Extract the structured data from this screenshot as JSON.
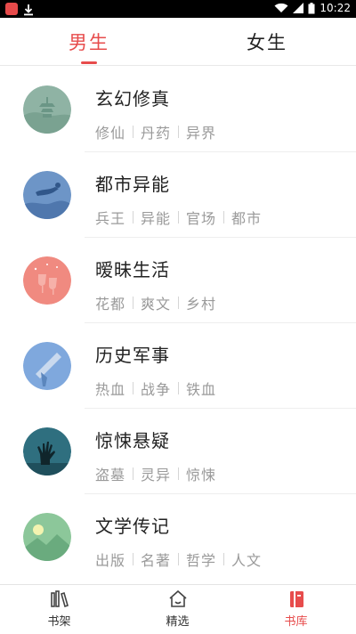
{
  "status_bar": {
    "time": "10:22"
  },
  "tabs": [
    {
      "label": "男生",
      "active": true
    },
    {
      "label": "女生",
      "active": false
    }
  ],
  "categories": [
    {
      "title": "玄幻修真",
      "tags": [
        "修仙",
        "丹药",
        "异界"
      ],
      "icon": "pagoda-icon",
      "color": "#8fb3a4"
    },
    {
      "title": "都市异能",
      "tags": [
        "兵王",
        "异能",
        "官场",
        "都市"
      ],
      "icon": "diver-icon",
      "color": "#6d95c7"
    },
    {
      "title": "暧昧生活",
      "tags": [
        "花都",
        "爽文",
        "乡村"
      ],
      "icon": "wine-glasses-icon",
      "color": "#f08a80"
    },
    {
      "title": "历史军事",
      "tags": [
        "热血",
        "战争",
        "铁血"
      ],
      "icon": "telescope-icon",
      "color": "#7fa8dd"
    },
    {
      "title": "惊悚悬疑",
      "tags": [
        "盗墓",
        "灵异",
        "惊悚"
      ],
      "icon": "zombie-hand-icon",
      "color": "#2f6f7f"
    },
    {
      "title": "文学传记",
      "tags": [
        "出版",
        "名著",
        "哲学",
        "人文"
      ],
      "icon": "landscape-icon",
      "color": "#8cc79a"
    }
  ],
  "bottom_nav": [
    {
      "label": "书架",
      "icon": "bookshelf-icon",
      "active": false
    },
    {
      "label": "精选",
      "icon": "home-icon",
      "active": false
    },
    {
      "label": "书库",
      "icon": "library-icon",
      "active": true
    }
  ],
  "colors": {
    "accent": "#e74c4c",
    "tag_text": "#9a9a9a"
  }
}
